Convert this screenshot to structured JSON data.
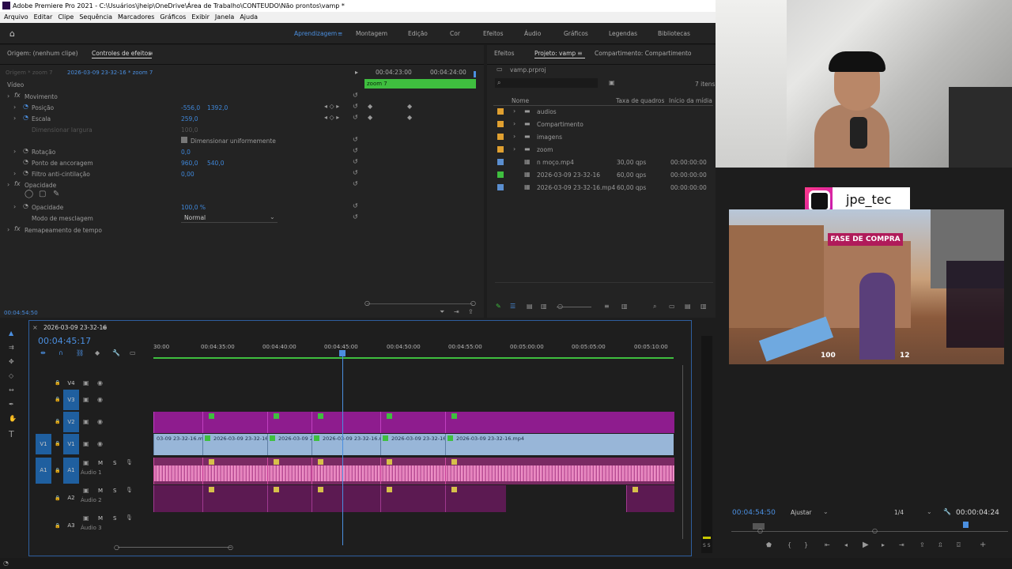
{
  "window": {
    "title": "Adobe Premiere Pro 2021 - C:\\Usuários\\jheip\\OneDrive\\Área de Trabalho\\CONTEUDO\\Não prontos\\vamp *"
  },
  "menu": [
    "Arquivo",
    "Editar",
    "Clipe",
    "Sequência",
    "Marcadores",
    "Gráficos",
    "Exibir",
    "Janela",
    "Ajuda"
  ],
  "workspaces": [
    "Aprendizagem",
    "Montagem",
    "Edição",
    "Cor",
    "Efeitos",
    "Áudio",
    "Gráficos",
    "Legendas",
    "Bibliotecas"
  ],
  "effects_panel": {
    "tabs": [
      "Origem: (nenhum clipe)",
      "Controles de efeitos"
    ],
    "master": "Origem * zoom 7",
    "clip": "2026-03-09 23-32-16 * zoom 7",
    "timecodes": [
      "00:04:23:00",
      "00:04:24:00"
    ],
    "clip_bar": "zoom 7",
    "section_video": "Vídeo",
    "rows": [
      {
        "label": "Movimento",
        "value": "",
        "value2": ""
      },
      {
        "label": "Posição",
        "value": "-556,0",
        "value2": "1392,0"
      },
      {
        "label": "Escala",
        "value": "259,0",
        "value2": ""
      },
      {
        "label": "Dimensionar largura",
        "value": "100,0",
        "value2": ""
      },
      {
        "label": "Dimensionar uniformemente",
        "value": "",
        "value2": ""
      },
      {
        "label": "Rotação",
        "value": "0,0",
        "value2": ""
      },
      {
        "label": "Ponto de ancoragem",
        "value": "960,0",
        "value2": "540,0"
      },
      {
        "label": "Filtro anti-cintilação",
        "value": "0,00",
        "value2": ""
      },
      {
        "label": "Opacidade",
        "value": "",
        "value2": ""
      },
      {
        "label": "Opacidade",
        "value": "100,0 %",
        "value2": ""
      },
      {
        "label": "Modo de mesclagem",
        "value": "Normal",
        "value2": ""
      },
      {
        "label": "Remapeamento de tempo",
        "value": "",
        "value2": ""
      }
    ],
    "footer_time": "00:04:54:50"
  },
  "project_panel": {
    "tabs": [
      "Efeitos",
      "Projeto: vamp",
      "Compartimento: Compartimento"
    ],
    "project_file": "vamp.prproj",
    "item_count": "7 itens",
    "columns": [
      "Nome",
      "Taxa de quadros",
      "Início da mídia"
    ],
    "items": [
      {
        "name": "audios",
        "fps": "",
        "start": "",
        "color": "#e0a030"
      },
      {
        "name": "Compartimento",
        "fps": "",
        "start": "",
        "color": "#e0a030"
      },
      {
        "name": "imagens",
        "fps": "",
        "start": "",
        "color": "#e0a030"
      },
      {
        "name": "zoom",
        "fps": "",
        "start": "",
        "color": "#e0a030"
      },
      {
        "name": "n moço.mp4",
        "fps": "30,00 qps",
        "start": "00:00:00:00",
        "color": "#5b8fd0"
      },
      {
        "name": "2026-03-09 23-32-16",
        "fps": "60,00 qps",
        "start": "00:00:00:00",
        "color": "#3fbf3f"
      },
      {
        "name": "2026-03-09 23-32-16.mp4",
        "fps": "60,00 qps",
        "start": "00:00:00:00",
        "color": "#5b8fd0"
      }
    ]
  },
  "timeline": {
    "sequence": "2026-03-09 23-32-16",
    "timecode": "00:04:45:17",
    "ruler": [
      "30:00",
      "00:04:35:00",
      "00:04:40:00",
      "00:04:45:00",
      "00:04:50:00",
      "00:04:55:00",
      "00:05:00:00",
      "00:05:05:00",
      "00:05:10:00"
    ],
    "tracks_video": [
      "V4",
      "V3",
      "V2",
      "V1"
    ],
    "tracks_audio": [
      "A1",
      "A2",
      "A3"
    ],
    "audio_names": [
      "Áudio 1",
      "Áudio 2",
      "Áudio 3"
    ],
    "source_v1": "V1",
    "source_a1": "A1",
    "v1_clips": [
      "03-09 23-32-16.mp4",
      "2026-03-09 23-32-16.",
      "2026-03-09 2",
      "2026-03-09 23-32-16.m",
      "2026-03-09 23-32-16.",
      "2026-03-09 23-32-16.mp4"
    ],
    "btn_m": "M",
    "btn_s": "S"
  },
  "program": {
    "time": "00:04:54:50",
    "fit": "Ajustar",
    "quality": "1/4",
    "duration": "00:00:04:24"
  },
  "overlay": {
    "handle": "jpe_tec",
    "game_banner": "FASE DE COMPRA",
    "hp": "100",
    "ammo": "12"
  },
  "colors": {
    "accent": "#4b8fe0",
    "green_bar": "#3fbf3f",
    "clip_pink": "#8e1c8e",
    "clip_blue": "#98b6d8"
  }
}
